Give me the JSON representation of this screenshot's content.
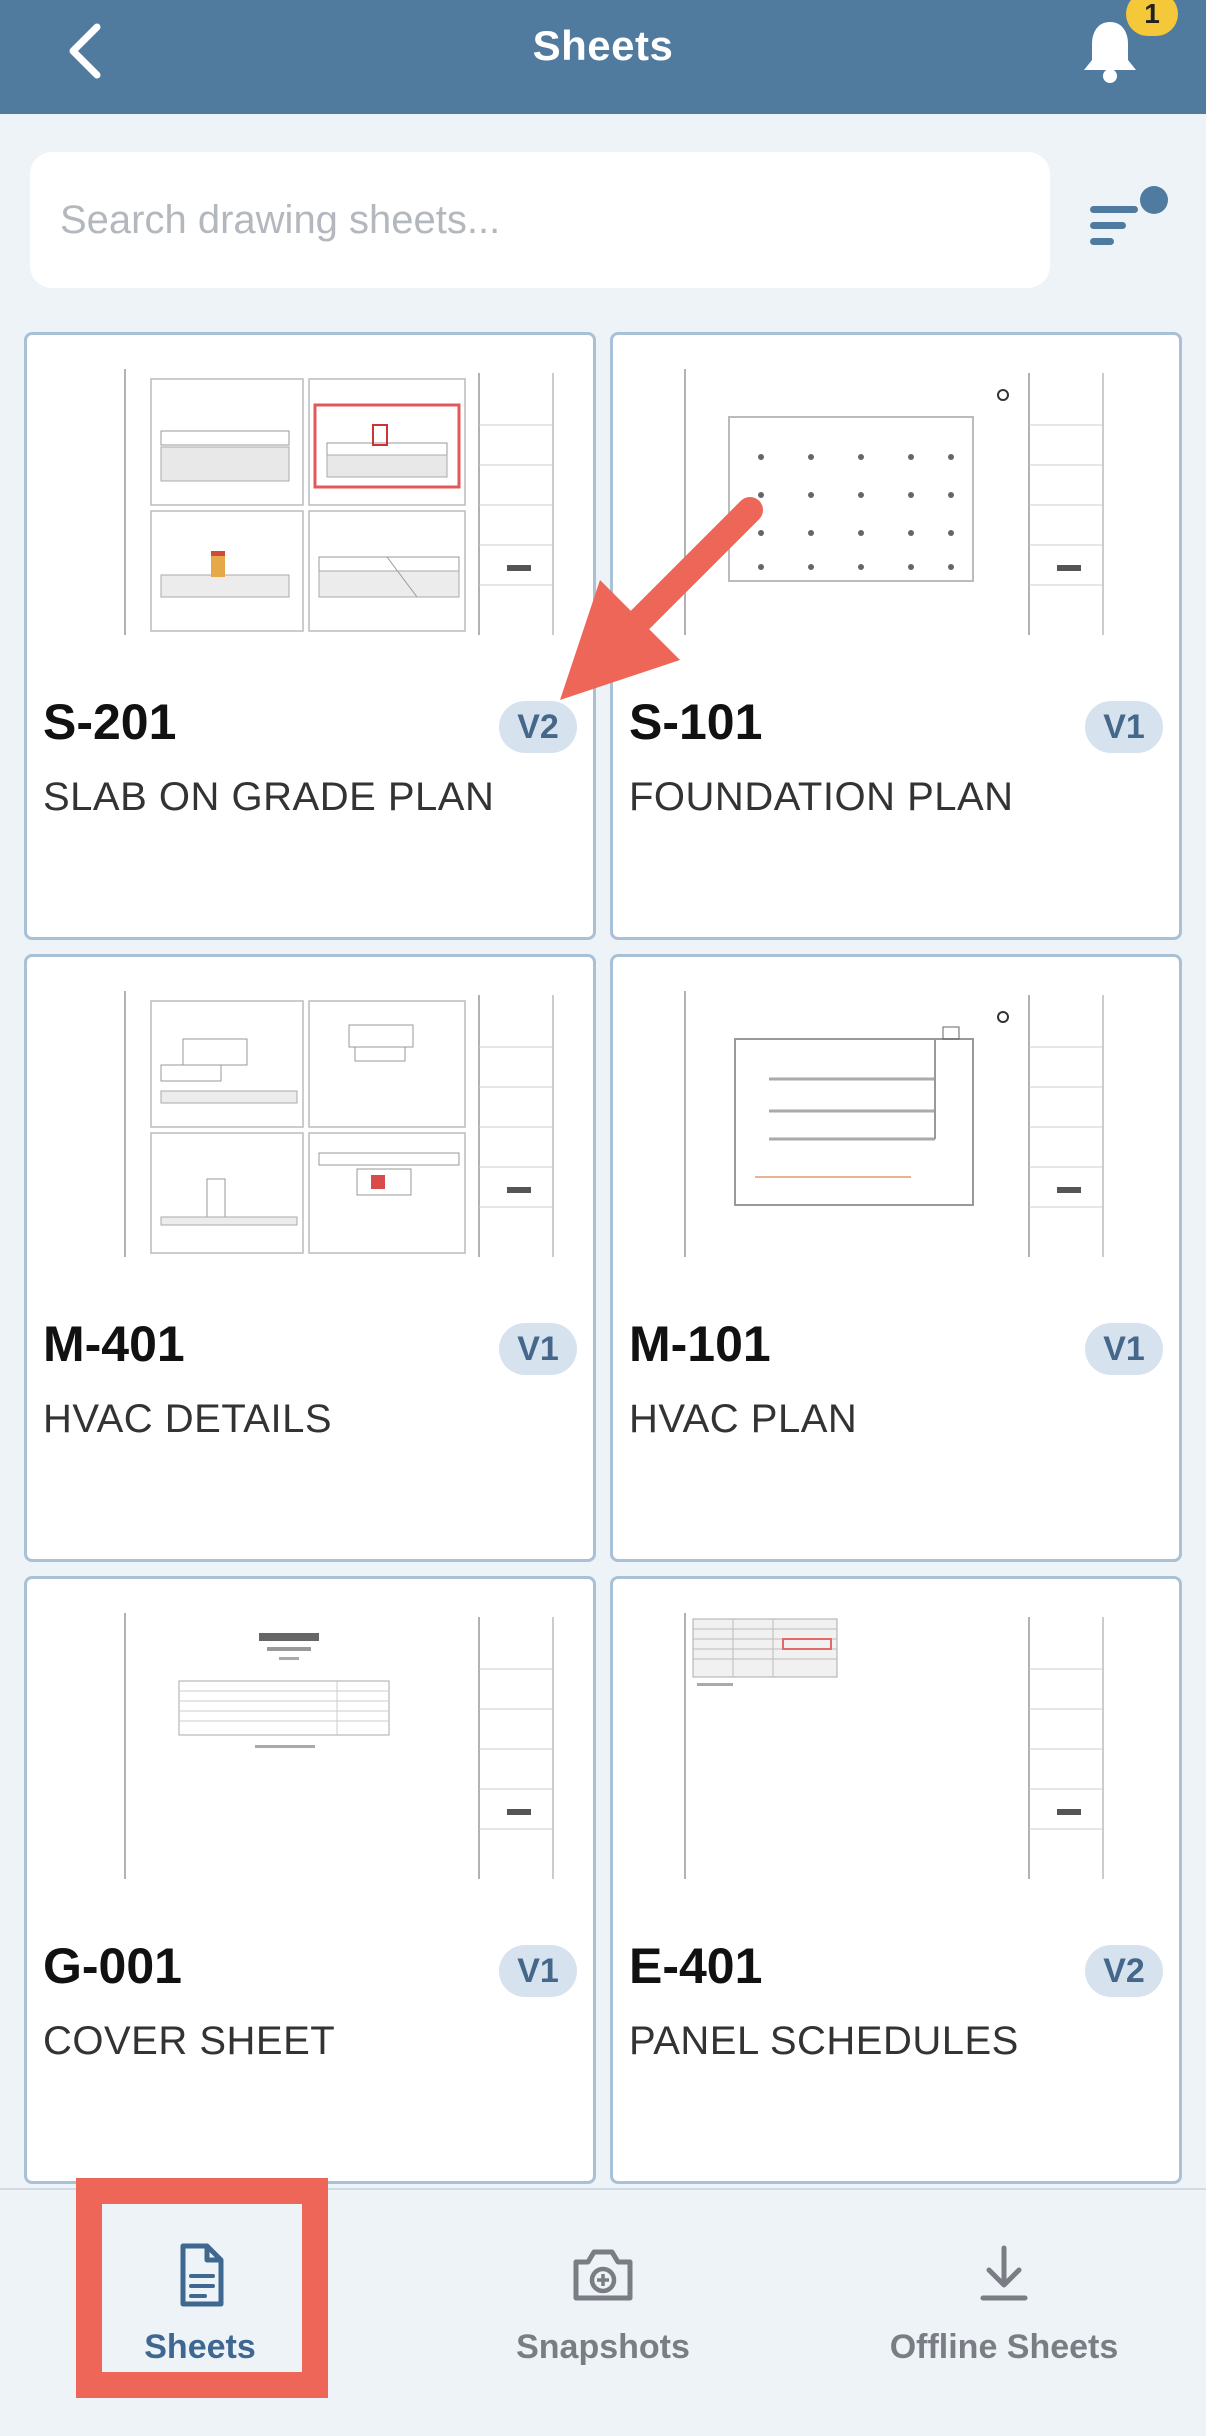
{
  "header": {
    "title": "Sheets",
    "notification_count": "1"
  },
  "search": {
    "placeholder": "Search drawing sheets..."
  },
  "sheets": [
    {
      "number": "S-201",
      "version": "V2",
      "title": "SLAB ON GRADE PLAN"
    },
    {
      "number": "S-101",
      "version": "V1",
      "title": "FOUNDATION PLAN"
    },
    {
      "number": "M-401",
      "version": "V1",
      "title": "HVAC DETAILS"
    },
    {
      "number": "M-101",
      "version": "V1",
      "title": "HVAC PLAN"
    },
    {
      "number": "G-001",
      "version": "V1",
      "title": "COVER SHEET"
    },
    {
      "number": "E-401",
      "version": "V2",
      "title": "PANEL SCHEDULES"
    }
  ],
  "tabs": [
    {
      "label": "Sheets",
      "icon": "document-icon",
      "active": true
    },
    {
      "label": "Snapshots",
      "icon": "camera-icon",
      "active": false
    },
    {
      "label": "Offline Sheets",
      "icon": "download-icon",
      "active": false
    }
  ],
  "colors": {
    "header_bg": "#517b9e",
    "accent": "#3f6891",
    "badge": "#f5c83a",
    "annotation": "#ee6657"
  }
}
